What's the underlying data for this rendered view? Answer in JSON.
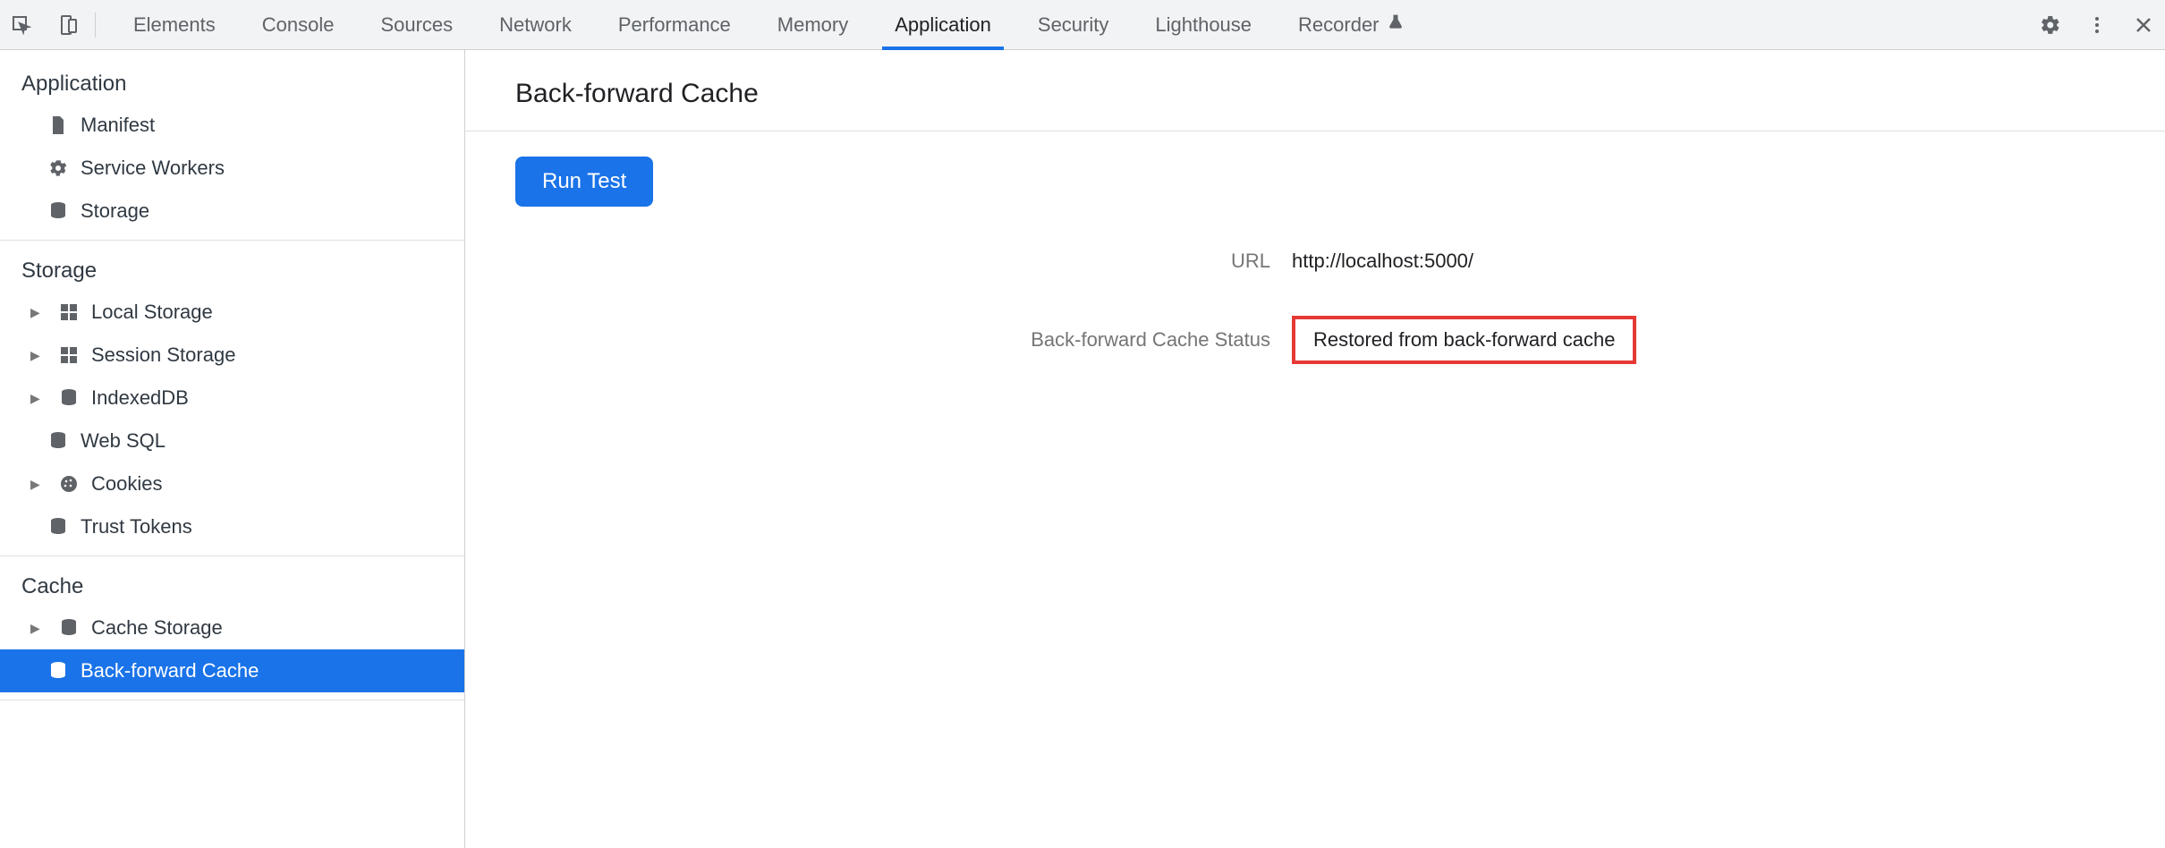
{
  "topbar": {
    "tabs": [
      {
        "label": "Elements"
      },
      {
        "label": "Console"
      },
      {
        "label": "Sources"
      },
      {
        "label": "Network"
      },
      {
        "label": "Performance"
      },
      {
        "label": "Memory"
      },
      {
        "label": "Application",
        "active": true
      },
      {
        "label": "Security"
      },
      {
        "label": "Lighthouse"
      },
      {
        "label": "Recorder"
      }
    ]
  },
  "sidebar": {
    "section_application": "Application",
    "section_storage": "Storage",
    "section_cache": "Cache",
    "items_app": [
      {
        "label": "Manifest",
        "icon": "file"
      },
      {
        "label": "Service Workers",
        "icon": "gear"
      },
      {
        "label": "Storage",
        "icon": "db"
      }
    ],
    "items_storage": [
      {
        "label": "Local Storage",
        "icon": "grid",
        "expandable": true
      },
      {
        "label": "Session Storage",
        "icon": "grid",
        "expandable": true
      },
      {
        "label": "IndexedDB",
        "icon": "db",
        "expandable": true
      },
      {
        "label": "Web SQL",
        "icon": "db"
      },
      {
        "label": "Cookies",
        "icon": "cookie",
        "expandable": true
      },
      {
        "label": "Trust Tokens",
        "icon": "db"
      }
    ],
    "items_cache": [
      {
        "label": "Cache Storage",
        "icon": "db",
        "expandable": true
      },
      {
        "label": "Back-forward Cache",
        "icon": "db",
        "selected": true
      }
    ]
  },
  "main": {
    "title": "Back-forward Cache",
    "run_button": "Run Test",
    "url_label": "URL",
    "url_value": "http://localhost:5000/",
    "status_label": "Back-forward Cache Status",
    "status_value": "Restored from back-forward cache"
  }
}
